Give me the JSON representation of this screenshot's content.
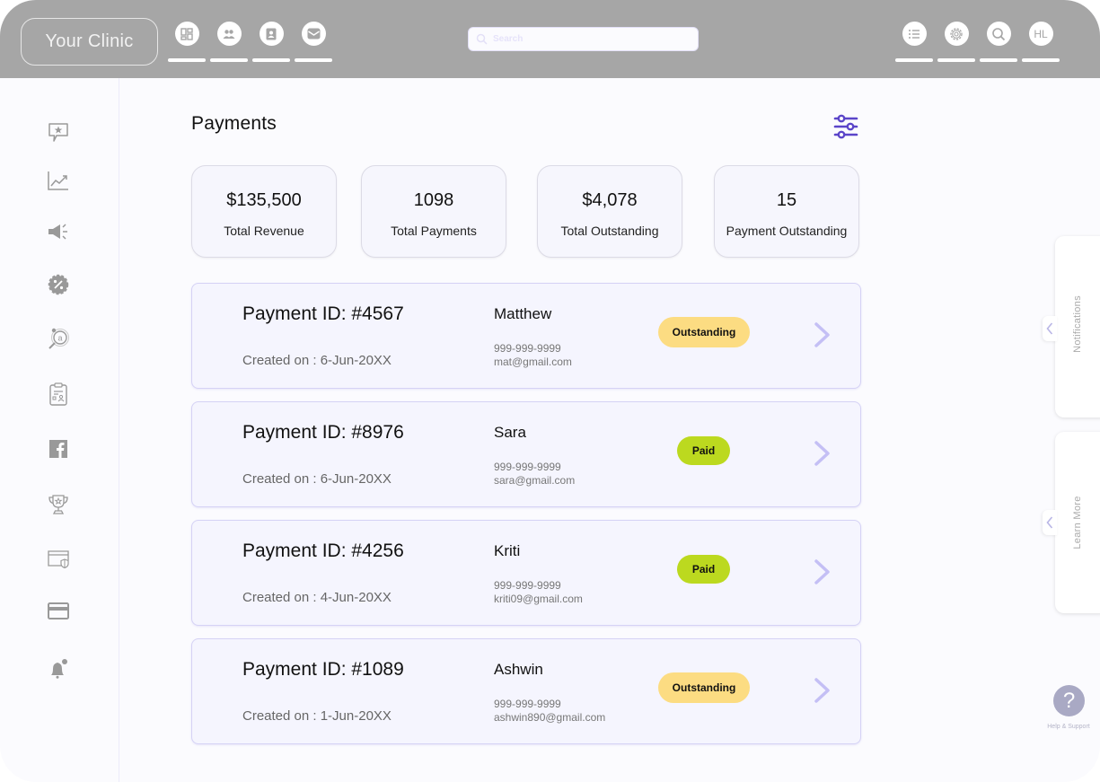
{
  "header": {
    "brand": "Your Clinic",
    "left_nav": [
      {
        "icon": "dashboard-icon"
      },
      {
        "icon": "users-icon"
      },
      {
        "icon": "contacts-icon"
      },
      {
        "icon": "mail-icon"
      }
    ],
    "search": {
      "placeholder": "Search",
      "value": ""
    },
    "right_nav": [
      {
        "icon": "list-icon"
      },
      {
        "icon": "gear-icon"
      },
      {
        "icon": "search-icon"
      },
      {
        "icon": "avatar",
        "label": "HL"
      }
    ]
  },
  "sidebar": {
    "items": [
      {
        "icon": "review-icon"
      },
      {
        "icon": "analytics-icon"
      },
      {
        "icon": "megaphone-icon"
      },
      {
        "icon": "discount-icon"
      },
      {
        "icon": "seo-search-icon"
      },
      {
        "icon": "clipboard-icon"
      },
      {
        "icon": "facebook-icon"
      },
      {
        "icon": "trophy-icon"
      },
      {
        "icon": "secure-window-icon"
      },
      {
        "icon": "credit-card-icon"
      },
      {
        "icon": "notification-bell-icon"
      }
    ]
  },
  "main": {
    "title": "Payments",
    "stats": [
      {
        "value": "$135,500",
        "label": "Total Revenue"
      },
      {
        "value": "1098",
        "label": "Total Payments"
      },
      {
        "value": "$4,078",
        "label": "Total Outstanding"
      },
      {
        "value": "15",
        "label": "Payment Outstanding"
      }
    ],
    "payments": [
      {
        "id": "Payment ID: #4567",
        "created": "Created on : 6-Jun-20XX",
        "name": "Matthew",
        "phone": "999-999-9999",
        "email": "mat@gmail.com",
        "status": "Outstanding"
      },
      {
        "id": "Payment ID: #8976",
        "created": "Created on : 6-Jun-20XX",
        "name": "Sara",
        "phone": "999-999-9999",
        "email": "sara@gmail.com",
        "status": "Paid"
      },
      {
        "id": "Payment ID: #4256",
        "created": "Created on : 4-Jun-20XX",
        "name": "Kriti",
        "phone": "999-999-9999",
        "email": "kriti09@gmail.com",
        "status": "Paid"
      },
      {
        "id": "Payment ID: #1089",
        "created": "Created on : 1-Jun-20XX",
        "name": "Ashwin",
        "phone": "999-999-9999",
        "email": "ashwin890@gmail.com",
        "status": "Outstanding"
      }
    ]
  },
  "right_panel": {
    "notifications_label": "Notifications",
    "learn_more_label": "Learn More",
    "help_label": "Help & Support",
    "help_icon_glyph": "?"
  },
  "colors": {
    "header_bg": "#a6a6a6",
    "accent": "#5b45c9",
    "outstanding": "#fcdc82",
    "paid": "#bcd91f",
    "chevron": "#c4bff5"
  }
}
